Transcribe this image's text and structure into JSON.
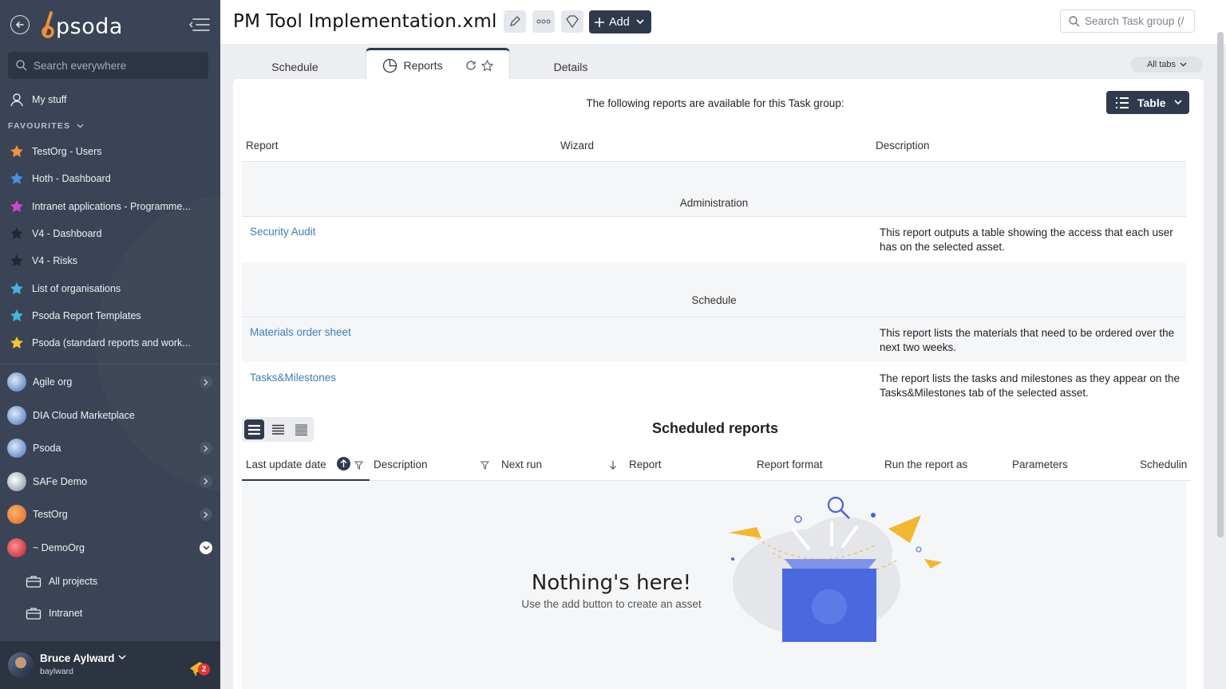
{
  "sidebar": {
    "logo": "psoda",
    "search_placeholder": "Search everywhere",
    "my_stuff": "My stuff",
    "favourites_heading": "FAVOURITES",
    "favourites": [
      {
        "label": "TestOrg - Users",
        "color": "#f0913a"
      },
      {
        "label": "Hoth - Dashboard",
        "color": "#4a8fe0"
      },
      {
        "label": "Intranet applications - Programme...",
        "color": "#d445c9"
      },
      {
        "label": "V4 - Dashboard",
        "color": "#222831"
      },
      {
        "label": "V4 - Risks",
        "color": "#222831"
      },
      {
        "label": "List of organisations",
        "color": "#42b6dc"
      },
      {
        "label": "Psoda Report Templates",
        "color": "#42b6dc"
      },
      {
        "label": "Psoda (standard reports and work...",
        "color": "#f2c431"
      }
    ],
    "orgs": [
      {
        "label": "Agile org",
        "has_chevron": true
      },
      {
        "label": "DIA Cloud Marketplace",
        "has_chevron": false
      },
      {
        "label": "Psoda",
        "has_chevron": true
      },
      {
        "label": "SAFe Demo",
        "has_chevron": true
      },
      {
        "label": "TestOrg",
        "has_chevron": true
      },
      {
        "label": "~ DemoOrg",
        "has_chevron": true,
        "expanded": true
      }
    ],
    "sub_items": [
      {
        "label": "All projects"
      },
      {
        "label": "Intranet"
      }
    ],
    "user": {
      "name": "Bruce Aylward",
      "login": "baylward",
      "notifications": "2"
    }
  },
  "header": {
    "title": "PM Tool Implementation.xml",
    "add_label": "Add",
    "search_placeholder": "Search Task group (/"
  },
  "tabs": {
    "items": [
      "Schedule",
      "Reports",
      "Details"
    ],
    "active": "Reports",
    "all_tabs_label": "All tabs"
  },
  "reports": {
    "intro": "The following reports are available for this Task group:",
    "view_label": "Table",
    "columns": [
      "Report",
      "Wizard",
      "Description"
    ],
    "groups": [
      {
        "name": "Administration",
        "rows": [
          {
            "report": "Security Audit",
            "wizard": "",
            "description": "This report outputs a table showing the access that each user has on the selected asset."
          }
        ]
      },
      {
        "name": "Schedule",
        "rows": [
          {
            "report": "Materials order sheet",
            "wizard": "",
            "description": "This report lists the materials that need to be ordered over the next two weeks."
          },
          {
            "report": "Tasks&Milestones",
            "wizard": "",
            "description": "The report lists the tasks and milestones as they appear on the Tasks&Milestones tab of the selected asset."
          }
        ]
      }
    ]
  },
  "scheduled": {
    "title": "Scheduled reports",
    "columns": [
      "Last update date",
      "Description",
      "Next run",
      "Report",
      "Report format",
      "Run the report as",
      "Parameters",
      "Schedulin"
    ],
    "empty_title": "Nothing's here!",
    "empty_subtitle": "Use the add button to create an asset"
  },
  "colors": {
    "sidebar_bg": "#3a4456",
    "primary_dark": "#2f3a4d",
    "link": "#3f7db3",
    "accent_orange": "#f0913a"
  }
}
